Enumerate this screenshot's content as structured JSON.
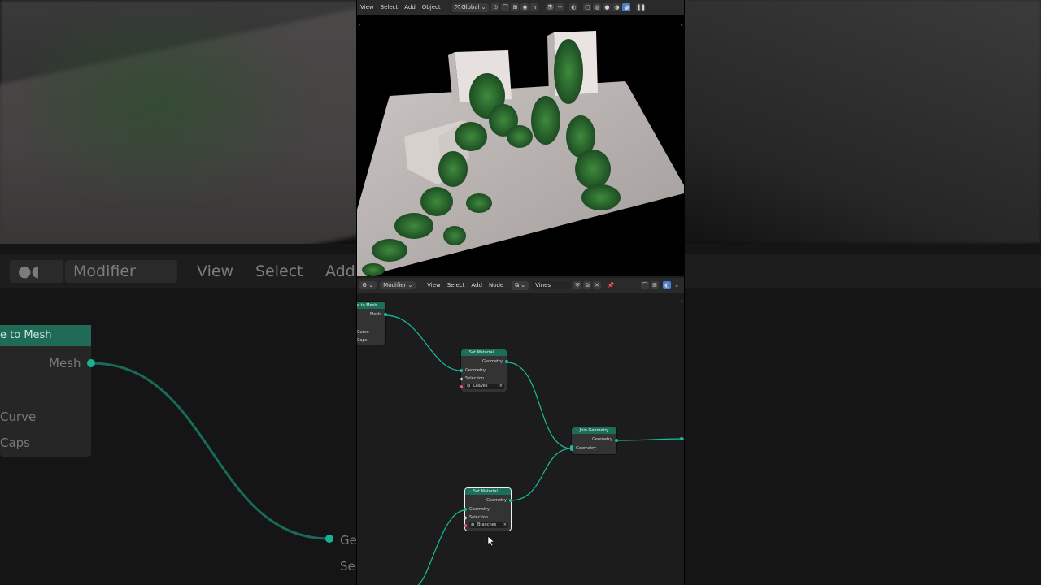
{
  "background": {
    "header": {
      "editor_type": "Modifier",
      "menu": [
        "View",
        "Select",
        "Add"
      ]
    },
    "node_header": "e to Mesh",
    "node_output": "Mesh",
    "node_inputs": [
      "Curve",
      "Caps"
    ],
    "right_node_labels": [
      "Ge",
      "Se"
    ]
  },
  "viewport_header": {
    "menus": [
      "View",
      "Select",
      "Add",
      "Object"
    ],
    "transform_orientation": "Global"
  },
  "node_editor": {
    "header": {
      "editor_type": "Modifier",
      "menus": [
        "View",
        "Select",
        "Add",
        "Node"
      ],
      "node_group": "Vines"
    },
    "nodes": {
      "curve_to_mesh": {
        "title": "e to Mesh",
        "output": "Mesh",
        "inputs": [
          "Curve",
          "Caps"
        ]
      },
      "set_material_leaves": {
        "title": "Set Material",
        "output": "Geometry",
        "inputs": [
          "Geometry",
          "Selection"
        ],
        "material": "Leaves"
      },
      "join_geometry": {
        "title": "Join Geometry",
        "output": "Geometry",
        "input": "Geometry"
      },
      "set_material_branches": {
        "title": "Set Material",
        "output": "Geometry",
        "inputs": [
          "Geometry",
          "Selection"
        ],
        "material": "Branches"
      }
    }
  },
  "colors": {
    "node_header": "#1b6f59",
    "link": "#14c09c",
    "accent_blue": "#4a7fd0"
  }
}
